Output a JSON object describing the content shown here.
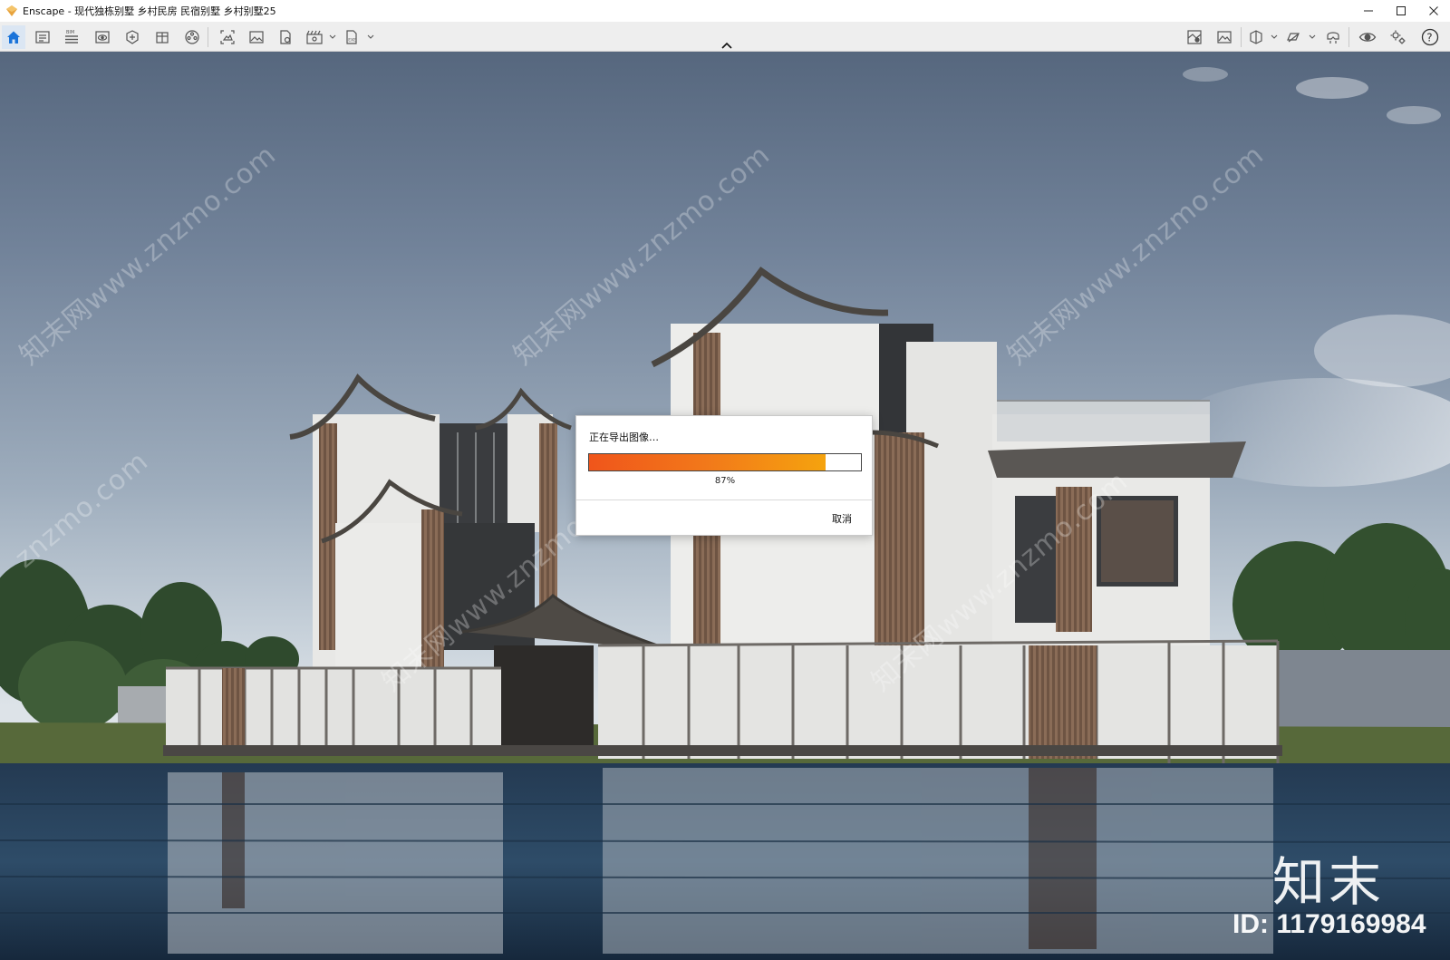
{
  "window": {
    "title": "Enscape - 现代独栋别墅 乡村民房 民宿别墅 乡村别墅25",
    "controls": [
      "minimize-icon",
      "maximize-icon",
      "close-icon"
    ]
  },
  "toolbar": {
    "left_buttons": [
      {
        "name": "home-icon",
        "active": true
      },
      {
        "name": "settings-sheet-icon"
      },
      {
        "name": "bim-list-icon",
        "label": "BIM"
      },
      {
        "name": "view-icon"
      },
      {
        "name": "asset-library-icon"
      },
      {
        "name": "material-editor-icon"
      },
      {
        "name": "video-editor-icon"
      },
      {
        "name": "screenshot-icon"
      },
      {
        "name": "batch-render-icon"
      },
      {
        "name": "panorama-icon"
      },
      {
        "name": "export-video-icon"
      },
      {
        "name": "export-exe-icon"
      }
    ],
    "right_buttons": [
      {
        "name": "map-icon"
      },
      {
        "name": "gallery-icon"
      },
      {
        "name": "view-mode-icon"
      },
      {
        "name": "orthographic-icon"
      },
      {
        "name": "vr-headset-icon"
      },
      {
        "name": "eye-icon"
      },
      {
        "name": "gears-icon"
      },
      {
        "name": "help-icon"
      }
    ]
  },
  "dialog": {
    "title": "正在导出图像…",
    "progress": 0.87,
    "progress_label": "87%",
    "cancel_label": "取消"
  },
  "watermark": {
    "diagonal_text": "知末网www.znzmo.com",
    "diagonal_text_short": "znzmo.com",
    "brand": "知末",
    "id_label": "ID: 1179169984"
  },
  "colors": {
    "accent": "#0a78d7",
    "progress_start": "#f0551b",
    "progress_end": "#f5a30e"
  }
}
